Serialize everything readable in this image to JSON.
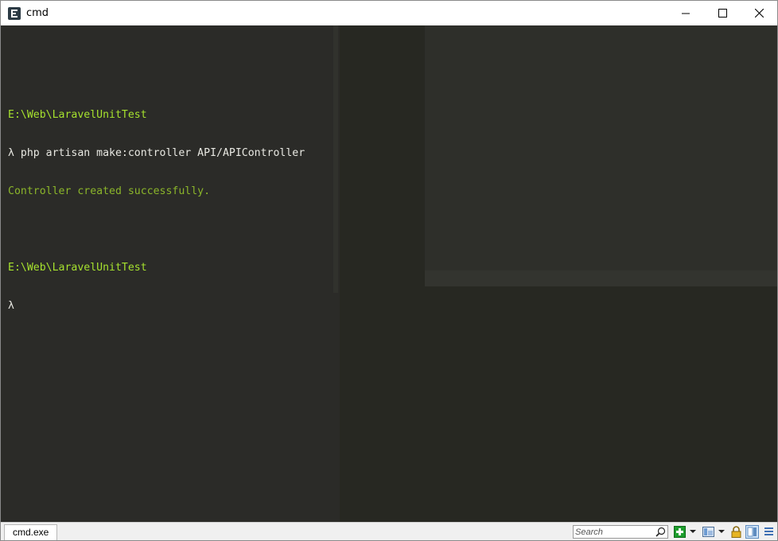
{
  "window": {
    "title": "cmd",
    "controls": {
      "minimize": "minimize",
      "maximize": "maximize",
      "close": "close"
    }
  },
  "terminal": {
    "lines": [
      {
        "type": "blank",
        "text": ""
      },
      {
        "type": "path",
        "text": "E:\\Web\\LaravelUnitTest"
      },
      {
        "type": "cmd",
        "text": "λ php artisan make:controller API/APIController"
      },
      {
        "type": "ok",
        "text": "Controller created successfully."
      },
      {
        "type": "blank",
        "text": ""
      },
      {
        "type": "path",
        "text": "E:\\Web\\LaravelUnitTest"
      },
      {
        "type": "cmd",
        "text": "λ"
      }
    ]
  },
  "statusbar": {
    "tab_label": "cmd.exe",
    "search_placeholder": "Search"
  },
  "colors": {
    "console_bg": "#272822",
    "path_green": "#a6e22e",
    "success_green": "#8bb52a",
    "command_text": "#e8e8e2"
  },
  "icons": [
    "cmder-app-icon",
    "minimize-icon",
    "maximize-icon",
    "close-icon",
    "search-icon",
    "new-console-icon",
    "layout-icon",
    "lock-icon",
    "split-view-icon",
    "menu-lines-icon"
  ]
}
